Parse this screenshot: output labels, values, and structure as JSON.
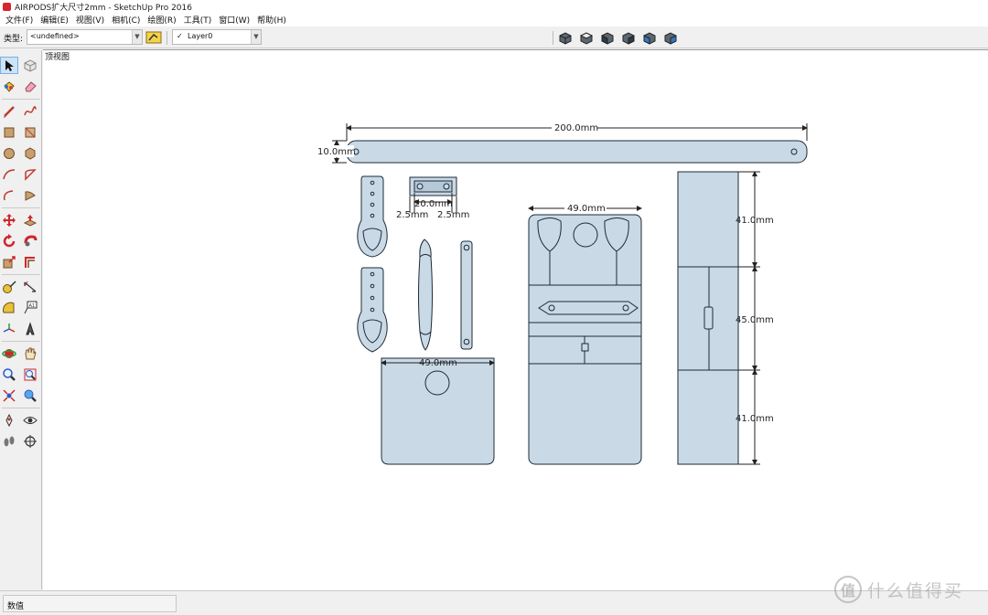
{
  "window": {
    "title": "AIRPODS扩大尺寸2mm - SketchUp Pro 2016"
  },
  "menu": [
    "文件(F)",
    "编辑(E)",
    "视图(V)",
    "相机(C)",
    "绘图(R)",
    "工具(T)",
    "窗口(W)",
    "帮助(H)"
  ],
  "toolbar": {
    "type_label": "类型:",
    "type_value": "<undefined>",
    "layer_value": "Layer0",
    "view_buttons": [
      "iso-view-icon",
      "top-view-icon",
      "front-view-icon",
      "right-view-icon",
      "back-view-icon",
      "left-view-icon"
    ]
  },
  "tools": [
    "select-icon",
    "make-component-icon",
    "paint-bucket-icon",
    "eraser-icon",
    "pencil-icon",
    "freehand-icon",
    "rectangle-icon",
    "rotated-rectangle-icon",
    "circle-icon",
    "polygon-icon",
    "arc-icon",
    "pie-icon",
    "two-point-arc-icon",
    "three-point-arc-icon",
    "move-icon",
    "push-pull-icon",
    "rotate-icon",
    "follow-me-icon",
    "scale-icon",
    "offset-icon",
    "tape-measure-icon",
    "dimension-icon",
    "protractor-icon",
    "text-icon",
    "axes-icon",
    "3d-text-icon",
    "orbit-icon",
    "pan-icon",
    "zoom-icon",
    "zoom-window-icon",
    "zoom-extents-icon",
    "previous-view-icon",
    "position-camera-icon",
    "look-around-icon",
    "walk-icon",
    "section-plane-icon"
  ],
  "canvas": {
    "view_label": "顶视图",
    "dimensions": {
      "bar_length": "200.0mm",
      "bar_width": "10.0mm",
      "clip_width": "20.0mm",
      "clip_left_gap": "2.5mm",
      "clip_right_gap": "2.5mm",
      "front_panel_width": "49.0mm",
      "lid_width": "49.0mm",
      "side_top_height": "41.0mm",
      "side_middle_height": "45.0mm",
      "side_bottom_height": "41.0mm"
    },
    "colors": {
      "part_fill": "#c9d9e6",
      "line": "#1e2a36",
      "dim_line": "#222222"
    }
  },
  "status": {
    "value_label": "数值"
  },
  "watermark": {
    "mark": "值",
    "text": "什么值得买"
  }
}
